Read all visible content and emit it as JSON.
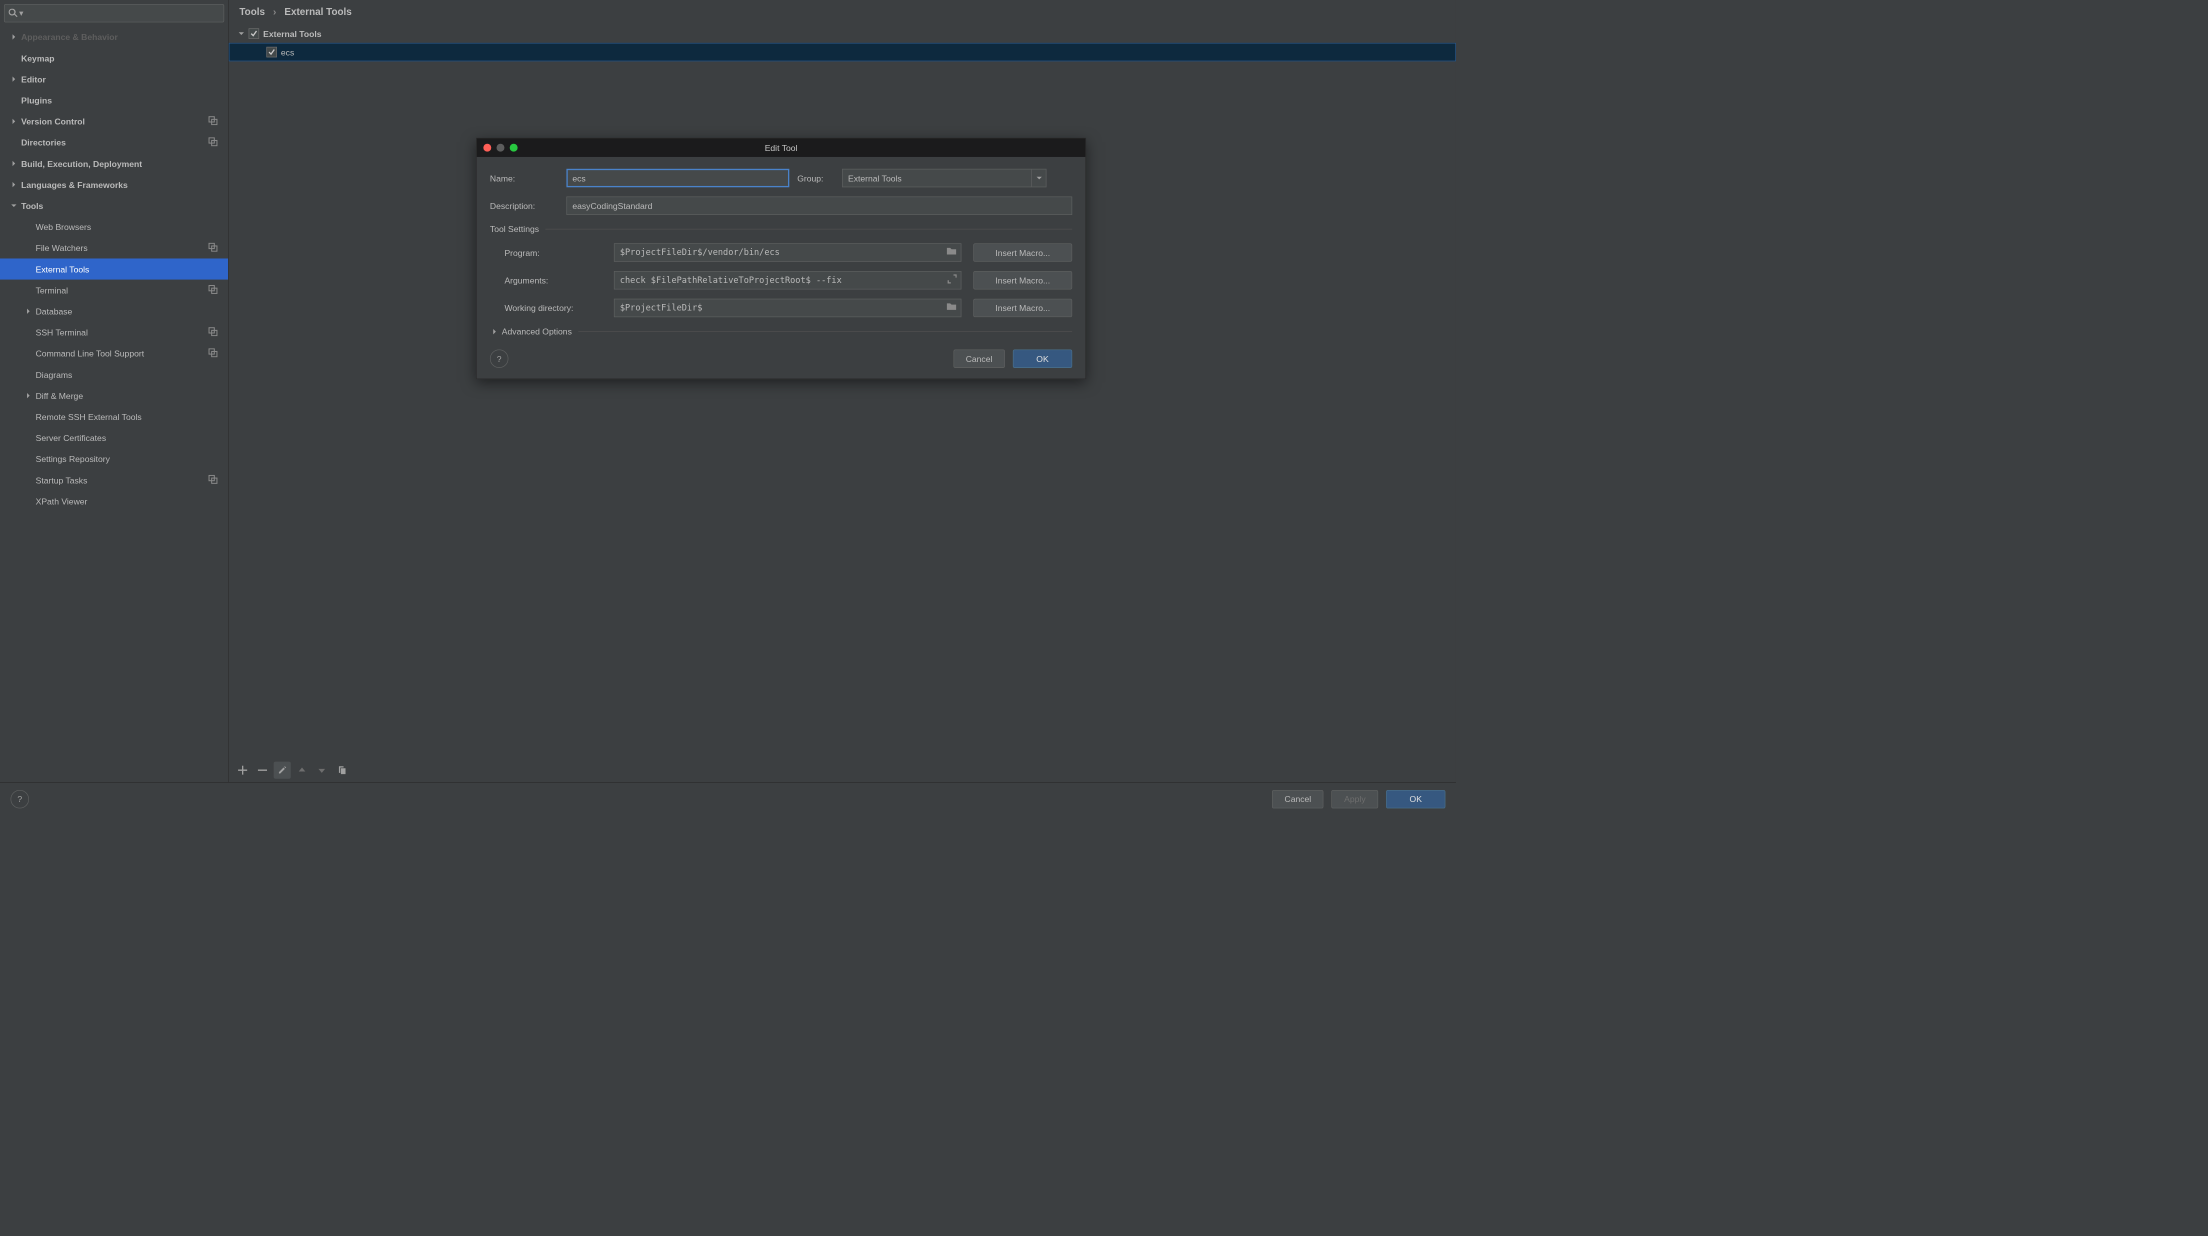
{
  "breadcrumb": {
    "parent": "Tools",
    "child": "External Tools"
  },
  "sidebar": {
    "items": [
      {
        "label": "Appearance & Behavior",
        "indent": 0,
        "arrow": "right",
        "dim": true,
        "trail": false
      },
      {
        "label": "Keymap",
        "indent": 0,
        "arrow": "none",
        "dim": false,
        "trail": false
      },
      {
        "label": "Editor",
        "indent": 0,
        "arrow": "right",
        "dim": false,
        "trail": false
      },
      {
        "label": "Plugins",
        "indent": 0,
        "arrow": "none",
        "dim": false,
        "trail": false
      },
      {
        "label": "Version Control",
        "indent": 0,
        "arrow": "right",
        "dim": false,
        "trail": true
      },
      {
        "label": "Directories",
        "indent": 0,
        "arrow": "none",
        "dim": false,
        "trail": true
      },
      {
        "label": "Build, Execution, Deployment",
        "indent": 0,
        "arrow": "right",
        "dim": false,
        "trail": false
      },
      {
        "label": "Languages & Frameworks",
        "indent": 0,
        "arrow": "right",
        "dim": false,
        "trail": false
      },
      {
        "label": "Tools",
        "indent": 0,
        "arrow": "down",
        "dim": false,
        "trail": false
      },
      {
        "label": "Web Browsers",
        "indent": 1,
        "arrow": "none",
        "dim": false,
        "trail": false
      },
      {
        "label": "File Watchers",
        "indent": 1,
        "arrow": "none",
        "dim": false,
        "trail": true
      },
      {
        "label": "External Tools",
        "indent": 1,
        "arrow": "none",
        "dim": false,
        "trail": false,
        "selected": true
      },
      {
        "label": "Terminal",
        "indent": 1,
        "arrow": "none",
        "dim": false,
        "trail": true
      },
      {
        "label": "Database",
        "indent": 1,
        "arrow": "right",
        "dim": false,
        "trail": false
      },
      {
        "label": "SSH Terminal",
        "indent": 1,
        "arrow": "none",
        "dim": false,
        "trail": true
      },
      {
        "label": "Command Line Tool Support",
        "indent": 1,
        "arrow": "none",
        "dim": false,
        "trail": true
      },
      {
        "label": "Diagrams",
        "indent": 1,
        "arrow": "none",
        "dim": false,
        "trail": false
      },
      {
        "label": "Diff & Merge",
        "indent": 1,
        "arrow": "right",
        "dim": false,
        "trail": false
      },
      {
        "label": "Remote SSH External Tools",
        "indent": 1,
        "arrow": "none",
        "dim": false,
        "trail": false
      },
      {
        "label": "Server Certificates",
        "indent": 1,
        "arrow": "none",
        "dim": false,
        "trail": false
      },
      {
        "label": "Settings Repository",
        "indent": 1,
        "arrow": "none",
        "dim": false,
        "trail": false
      },
      {
        "label": "Startup Tasks",
        "indent": 1,
        "arrow": "none",
        "dim": false,
        "trail": true
      },
      {
        "label": "XPath Viewer",
        "indent": 1,
        "arrow": "none",
        "dim": false,
        "trail": false
      }
    ]
  },
  "content": {
    "group_label": "External Tools",
    "tool_label": "ecs"
  },
  "dialog": {
    "title": "Edit Tool",
    "name_label": "Name:",
    "name_value": "ecs",
    "group_label": "Group:",
    "group_value": "External Tools",
    "desc_label": "Description:",
    "desc_value": "easyCodingStandard",
    "section_tool_settings": "Tool Settings",
    "program_label": "Program:",
    "program_value": "$ProjectFileDir$/vendor/bin/ecs",
    "arguments_label": "Arguments:",
    "arguments_value": "check $FilePathRelativeToProjectRoot$ --fix",
    "workdir_label": "Working directory:",
    "workdir_value": "$ProjectFileDir$",
    "insert_macro": "Insert Macro...",
    "advanced_label": "Advanced Options",
    "cancel": "Cancel",
    "ok": "OK"
  },
  "footer": {
    "cancel": "Cancel",
    "apply": "Apply",
    "ok": "OK"
  }
}
